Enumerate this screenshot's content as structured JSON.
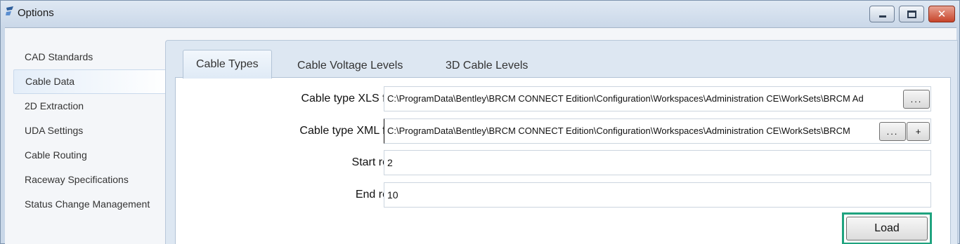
{
  "window": {
    "title": "Options",
    "close_glyph": "✕"
  },
  "sidebar": {
    "items": [
      {
        "label": "CAD Standards"
      },
      {
        "label": "Cable Data"
      },
      {
        "label": "2D Extraction"
      },
      {
        "label": "UDA Settings"
      },
      {
        "label": "Cable Routing"
      },
      {
        "label": "Raceway Specifications"
      },
      {
        "label": "Status Change Management"
      }
    ],
    "active_index": 1
  },
  "tabs": [
    {
      "label": "Cable Types"
    },
    {
      "label": "Cable Voltage Levels"
    },
    {
      "label": "3D Cable Levels"
    }
  ],
  "form": {
    "xls_label": "Cable type XLS file:",
    "xls_value": "C:\\ProgramData\\Bentley\\BRCM CONNECT Edition\\Configuration\\Workspaces\\Administration CE\\WorkSets\\BRCM Ad",
    "xls_browse": "...",
    "xml_label": "Cable type XML file:",
    "xml_value": "C:\\ProgramData\\Bentley\\BRCM CONNECT Edition\\Configuration\\Workspaces\\Administration CE\\WorkSets\\BRCM",
    "xml_browse": "...",
    "xml_add": "+",
    "start_label": "Start row:",
    "start_value": "2",
    "end_label": "End row:",
    "end_value": "10",
    "load_label": "Load"
  },
  "colors": {
    "highlight": "#1fa37f"
  }
}
